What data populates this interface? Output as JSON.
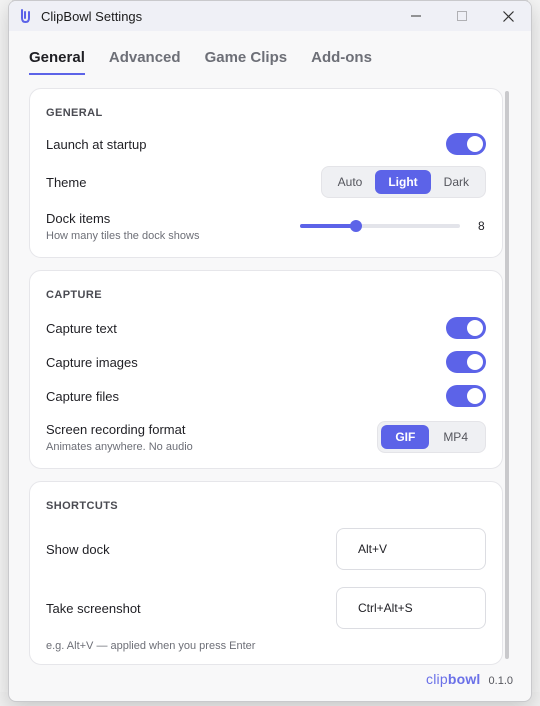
{
  "window": {
    "title": "ClipBowl Settings"
  },
  "tabs": [
    {
      "label": "General",
      "active": true
    },
    {
      "label": "Advanced",
      "active": false
    },
    {
      "label": "Game Clips",
      "active": false
    },
    {
      "label": "Add-ons",
      "active": false
    }
  ],
  "general": {
    "section_title": "GENERAL",
    "launch_label": "Launch at startup",
    "launch_on": true,
    "theme_label": "Theme",
    "theme_options": [
      "Auto",
      "Light",
      "Dark"
    ],
    "theme_selected": "Light",
    "dock_label": "Dock items",
    "dock_sublabel": "How many tiles the dock shows",
    "dock_value": "8",
    "dock_fraction": 0.35
  },
  "capture": {
    "section_title": "CAPTURE",
    "text_label": "Capture text",
    "images_label": "Capture images",
    "files_label": "Capture files",
    "format_label": "Screen recording format",
    "format_sublabel": "Animates anywhere. No audio",
    "format_options": [
      "GIF",
      "MP4"
    ],
    "format_selected": "GIF"
  },
  "shortcuts": {
    "section_title": "SHORTCUTS",
    "show_dock_label": "Show dock",
    "show_dock_value": "Alt+V",
    "screenshot_label": "Take screenshot",
    "screenshot_value": "Ctrl+Alt+S",
    "hint": "e.g. Alt+V — applied when you press Enter"
  },
  "footer": {
    "brand_prefix": "clip",
    "brand_suffix": "bowl",
    "version": "0.1.0"
  },
  "colors": {
    "accent": "#5c63e8"
  }
}
